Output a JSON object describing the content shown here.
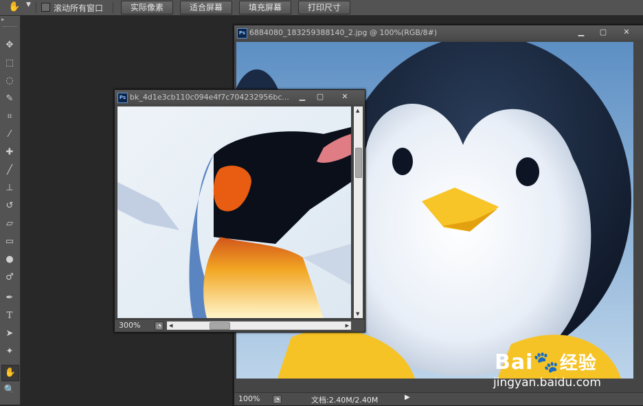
{
  "options_bar": {
    "checkbox_label": "滚动所有窗口",
    "buttons": [
      "实际像素",
      "适合屏幕",
      "填充屏幕",
      "打印尺寸"
    ]
  },
  "windows": {
    "main": {
      "title": "6884080_183259388140_2.jpg @ 100%(RGB/8#)",
      "zoom": "100%",
      "doc_info": "文档:2.40M/2.40M"
    },
    "small": {
      "title": "bk_4d1e3cb110c094e4f7c704232956bc...",
      "zoom": "300%"
    }
  },
  "watermark": {
    "brand": "Bai",
    "brand_cn": "经验",
    "url": "jingyan.baidu.com"
  },
  "icons": {
    "ps": "Ps",
    "minimize": "minimize-icon",
    "maximize": "maximize-icon",
    "close": "close-icon"
  }
}
